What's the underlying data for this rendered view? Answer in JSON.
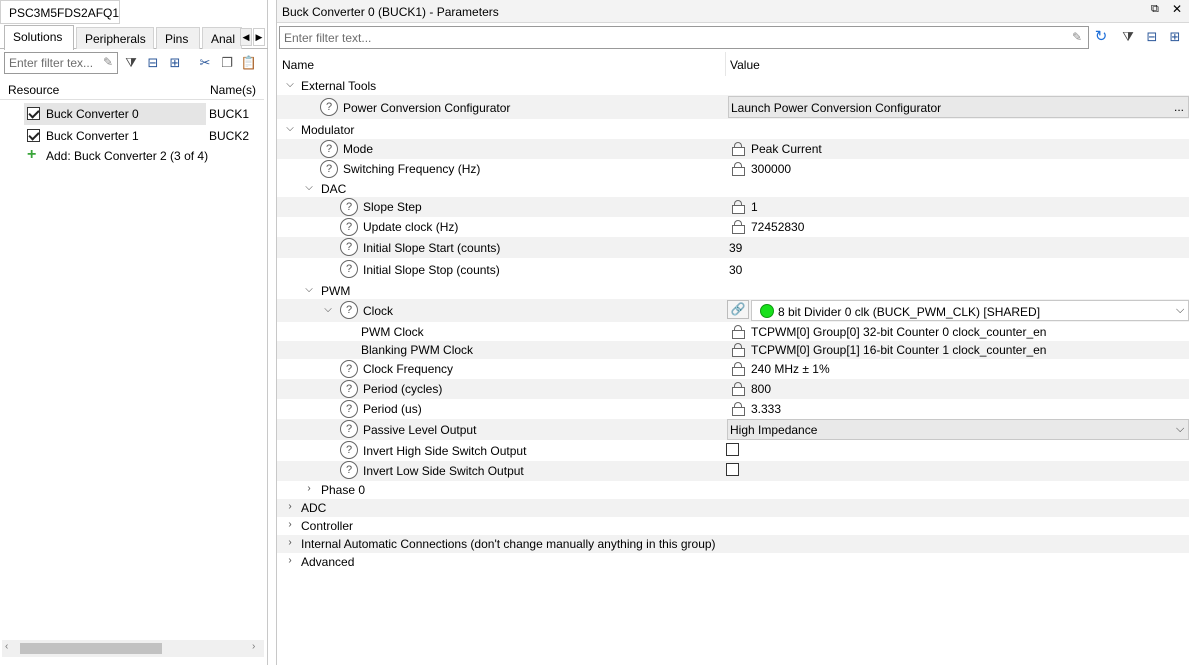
{
  "left": {
    "title": "PSC3M5FDS2AFQ1",
    "tabs": [
      "Solutions",
      "Peripherals",
      "Pins",
      "Anal"
    ],
    "filter_placeholder": "Enter filter tex...",
    "columns": {
      "resource": "Resource",
      "names": "Name(s)"
    },
    "items": [
      {
        "label": "Buck Converter 0",
        "name": "BUCK1",
        "checked": true,
        "selected": true
      },
      {
        "label": "Buck Converter 1",
        "name": "BUCK2",
        "checked": true,
        "selected": false
      }
    ],
    "add_label": "Add: Buck Converter 2 (3 of 4)"
  },
  "right": {
    "title": "Buck Converter 0 (BUCK1) - Parameters",
    "filter_placeholder": "Enter filter text...",
    "columns": {
      "name": "Name",
      "value": "Value"
    },
    "groups": {
      "external_tools": "External Tools",
      "pcc": {
        "label": "Power Conversion Configurator",
        "value": "Launch Power Conversion Configurator",
        "ellipsis": "..."
      },
      "modulator": "Modulator",
      "mode": {
        "label": "Mode",
        "value": "Peak Current"
      },
      "switching_freq": {
        "label": "Switching Frequency (Hz)",
        "value": "300000"
      },
      "dac": "DAC",
      "slope_step": {
        "label": "Slope Step",
        "value": "1"
      },
      "update_clock": {
        "label": "Update clock (Hz)",
        "value": "72452830"
      },
      "slope_start": {
        "label": "Initial Slope Start (counts)",
        "value": "39"
      },
      "slope_stop": {
        "label": "Initial Slope Stop (counts)",
        "value": "30"
      },
      "pwm": "PWM",
      "clock": {
        "label": "Clock",
        "value": "8 bit Divider 0 clk (BUCK_PWM_CLK) [SHARED]"
      },
      "pwm_clock": {
        "label": "PWM Clock",
        "value": "TCPWM[0] Group[0] 32-bit Counter 0 clock_counter_en"
      },
      "blanking_clock": {
        "label": "Blanking PWM Clock",
        "value": "TCPWM[0] Group[1] 16-bit Counter 1 clock_counter_en"
      },
      "clock_freq": {
        "label": "Clock Frequency",
        "value": "240 MHz ± 1%"
      },
      "period_cycles": {
        "label": "Period (cycles)",
        "value": "800"
      },
      "period_us": {
        "label": "Period (us)",
        "value": "3.333"
      },
      "passive_level": {
        "label": "Passive Level Output",
        "value": "High Impedance"
      },
      "invert_high": {
        "label": "Invert High Side Switch Output",
        "checked": false
      },
      "invert_low": {
        "label": "Invert Low Side Switch Output",
        "checked": false
      },
      "phase0": "Phase 0",
      "adc": "ADC",
      "controller": "Controller",
      "internal": "Internal Automatic Connections (don't change manually anything in this group)",
      "advanced": "Advanced"
    }
  },
  "icons": [
    "eraser-icon",
    "filter-icon",
    "collapse-icon",
    "expand-icon",
    "cut-icon",
    "copy-icon",
    "paste-icon",
    "refresh-icon",
    "help-icon",
    "lock-icon",
    "link-icon",
    "chevron-down-icon"
  ],
  "colors": {
    "green_status": "#18e01c",
    "accent": "#2b579a"
  }
}
